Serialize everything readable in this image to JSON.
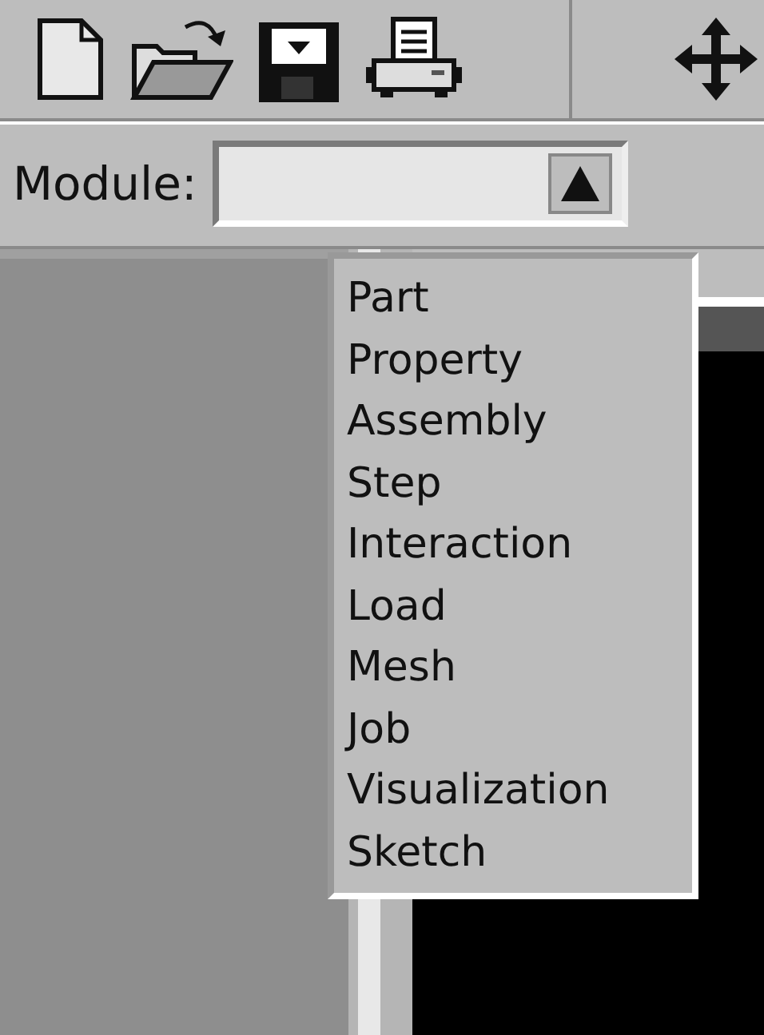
{
  "toolbar": {
    "buttons": [
      {
        "kind": "new"
      },
      {
        "kind": "open"
      },
      {
        "kind": "save"
      },
      {
        "kind": "print"
      },
      {
        "kind": "pan"
      }
    ]
  },
  "module": {
    "label": "Module:",
    "expanded": true,
    "options": [
      {
        "label": "Part"
      },
      {
        "label": "Property"
      },
      {
        "label": "Assembly"
      },
      {
        "label": "Step"
      },
      {
        "label": "Interaction"
      },
      {
        "label": "Load"
      },
      {
        "label": "Mesh"
      },
      {
        "label": "Job"
      },
      {
        "label": "Visualization"
      },
      {
        "label": "Sketch"
      }
    ]
  }
}
